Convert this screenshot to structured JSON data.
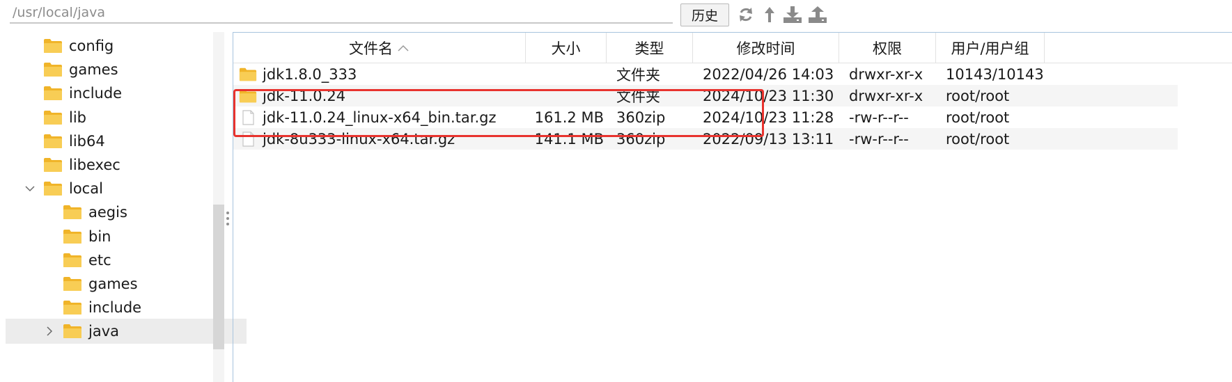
{
  "path_bar": {
    "path": "/usr/local/java",
    "history_label": "历史"
  },
  "toolbar_icons": [
    "refresh-icon",
    "parent-directory-icon",
    "download-icon",
    "upload-icon"
  ],
  "tree": {
    "items": [
      {
        "label": "config",
        "depth": 1,
        "expanded": false,
        "has_children": false,
        "selected": false
      },
      {
        "label": "games",
        "depth": 1,
        "expanded": false,
        "has_children": false,
        "selected": false
      },
      {
        "label": "include",
        "depth": 1,
        "expanded": false,
        "has_children": false,
        "selected": false
      },
      {
        "label": "lib",
        "depth": 1,
        "expanded": false,
        "has_children": false,
        "selected": false
      },
      {
        "label": "lib64",
        "depth": 1,
        "expanded": false,
        "has_children": false,
        "selected": false
      },
      {
        "label": "libexec",
        "depth": 1,
        "expanded": false,
        "has_children": false,
        "selected": false
      },
      {
        "label": "local",
        "depth": 1,
        "expanded": true,
        "has_children": true,
        "selected": false
      },
      {
        "label": "aegis",
        "depth": 2,
        "expanded": false,
        "has_children": false,
        "selected": false
      },
      {
        "label": "bin",
        "depth": 2,
        "expanded": false,
        "has_children": false,
        "selected": false
      },
      {
        "label": "etc",
        "depth": 2,
        "expanded": false,
        "has_children": false,
        "selected": false
      },
      {
        "label": "games",
        "depth": 2,
        "expanded": false,
        "has_children": false,
        "selected": false
      },
      {
        "label": "include",
        "depth": 2,
        "expanded": false,
        "has_children": false,
        "selected": false
      },
      {
        "label": "java",
        "depth": 2,
        "expanded": false,
        "has_children": true,
        "selected": true
      }
    ]
  },
  "table": {
    "columns": [
      {
        "label": "文件名",
        "sorted": "asc"
      },
      {
        "label": "大小"
      },
      {
        "label": "类型"
      },
      {
        "label": "修改时间"
      },
      {
        "label": "权限"
      },
      {
        "label": "用户/用户组"
      }
    ],
    "rows": [
      {
        "name": "jdk1.8.0_333",
        "kind": "folder",
        "size": "",
        "type": "文件夹",
        "modified": "2022/04/26 14:03",
        "permissions": "drwxr-xr-x",
        "owner": "10143/10143"
      },
      {
        "name": "jdk-11.0.24",
        "kind": "folder",
        "size": "",
        "type": "文件夹",
        "modified": "2024/10/23 11:30",
        "permissions": "drwxr-xr-x",
        "owner": "root/root"
      },
      {
        "name": "jdk-11.0.24_linux-x64_bin.tar.gz",
        "kind": "file",
        "size": "161.2 MB",
        "type": "360zip",
        "modified": "2024/10/23 11:28",
        "permissions": "-rw-r--r--",
        "owner": "root/root"
      },
      {
        "name": "jdk-8u333-linux-x64.tar.gz",
        "kind": "file",
        "size": "141.1 MB",
        "type": "360zip",
        "modified": "2022/09/13 13:11",
        "permissions": "-rw-r--r--",
        "owner": "root/root"
      }
    ]
  },
  "colors": {
    "highlight": "#e8332e",
    "folder": "#f6c445",
    "selected_row": "#ececec",
    "alt_row": "#f5f5f5"
  }
}
